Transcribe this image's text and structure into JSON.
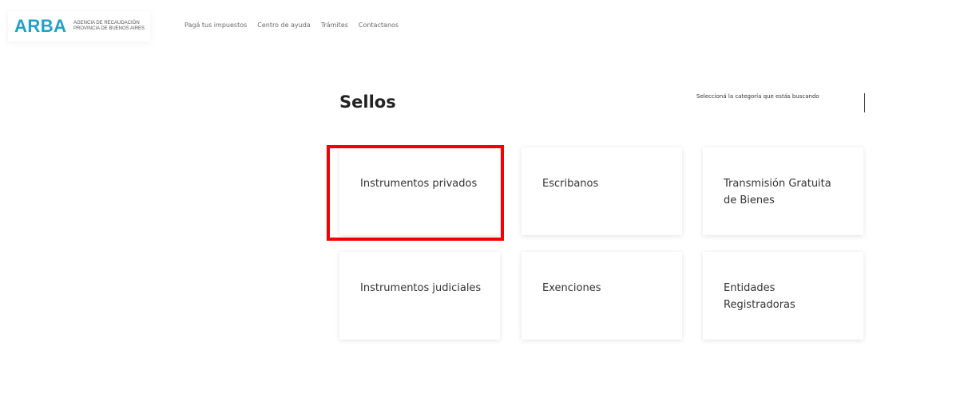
{
  "header": {
    "logo": {
      "word": "ARBA",
      "sub_line1": "AGENCIA DE RECAUDACIÓN",
      "sub_line2": "PROVINCIA DE BUENOS AIRES"
    },
    "nav": [
      {
        "label": "Pagá tus impuestos"
      },
      {
        "label": "Centro de ayuda"
      },
      {
        "label": "Trámites"
      },
      {
        "label": "Contactanos"
      }
    ]
  },
  "main": {
    "title": "Sellos",
    "category_hint": "Seleccioná la categoría que estás buscando",
    "cards": [
      {
        "label": "Instrumentos privados"
      },
      {
        "label": "Escribanos"
      },
      {
        "label": "Transmisión Gratuita de Bienes"
      },
      {
        "label": "Instrumentos judiciales"
      },
      {
        "label": "Exenciones"
      },
      {
        "label": "Entidades Registradoras"
      }
    ]
  },
  "colors": {
    "brand": "#1fa1c8",
    "highlight": "#f20000"
  }
}
